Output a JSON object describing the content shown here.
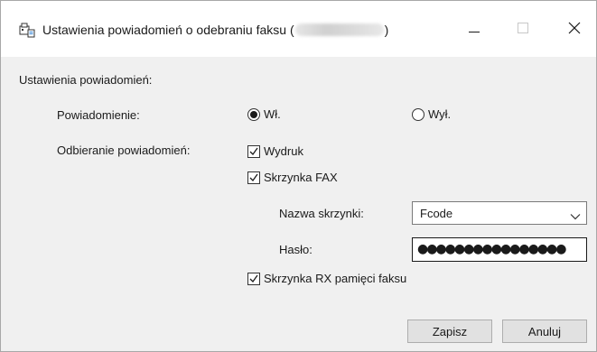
{
  "window": {
    "title_prefix": "Ustawienia powiadomień o odebraniu faksu (",
    "title_suffix": ")"
  },
  "section": {
    "heading": "Ustawienia powiadomień:"
  },
  "notification": {
    "label": "Powiadomienie:",
    "on_label": "Wł.",
    "off_label": "Wył.",
    "selected": "on"
  },
  "receiving": {
    "label": "Odbieranie powiadomień:",
    "print_label": "Wydruk",
    "print_checked": true,
    "fax_box_label": "Skrzynka FAX",
    "fax_box_checked": true,
    "box_name_label": "Nazwa skrzynki:",
    "box_name_value": "Fcode",
    "password_label": "Hasło:",
    "password_value": "●●●●●●●●●●●●●●●●",
    "memory_box_label": "Skrzynka RX pamięci faksu",
    "memory_box_checked": true
  },
  "buttons": {
    "save": "Zapisz",
    "cancel": "Anuluj"
  },
  "icons": {
    "app": "fax-settings-icon",
    "minimize": "minimize-icon",
    "maximize": "maximize-icon",
    "close": "close-icon",
    "dropdown": "chevron-down-icon"
  },
  "colors": {
    "dialog_bg": "#f0f0f0",
    "titlebar_bg": "#ffffff",
    "button_bg": "#e1e1e1"
  }
}
